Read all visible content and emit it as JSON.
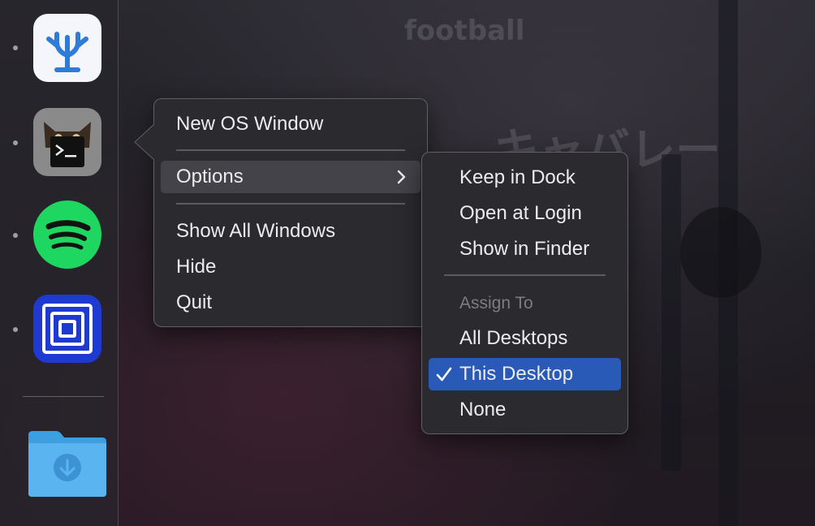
{
  "dock": {
    "apps": [
      {
        "name": "VSCodium",
        "icon": "vscodium-icon",
        "running": true
      },
      {
        "name": "kitty",
        "icon": "kitty-terminal-icon",
        "running": true
      },
      {
        "name": "Spotify",
        "icon": "spotify-icon",
        "running": true
      },
      {
        "name": "Ultimate",
        "icon": "concentric-squares-app-icon",
        "running": true
      }
    ],
    "folder": {
      "name": "Downloads",
      "icon": "downloads-folder-icon"
    }
  },
  "context_menu": {
    "new_os_window": "New OS Window",
    "options": "Options",
    "show_all_windows": "Show All Windows",
    "hide": "Hide",
    "quit": "Quit"
  },
  "options_submenu": {
    "keep_in_dock": "Keep in Dock",
    "open_at_login": "Open at Login",
    "show_in_finder": "Show in Finder",
    "assign_to_label": "Assign To",
    "all_desktops": "All Desktops",
    "this_desktop": "This Desktop",
    "none": "None",
    "checked": "This Desktop"
  },
  "wallpaper": {
    "text_football": "football",
    "text_japanese": "キャバレー"
  },
  "colors": {
    "highlight_blue": "#2a5ab8",
    "menu_bg": "#2b2a2f",
    "spotify_green": "#1ed760"
  }
}
